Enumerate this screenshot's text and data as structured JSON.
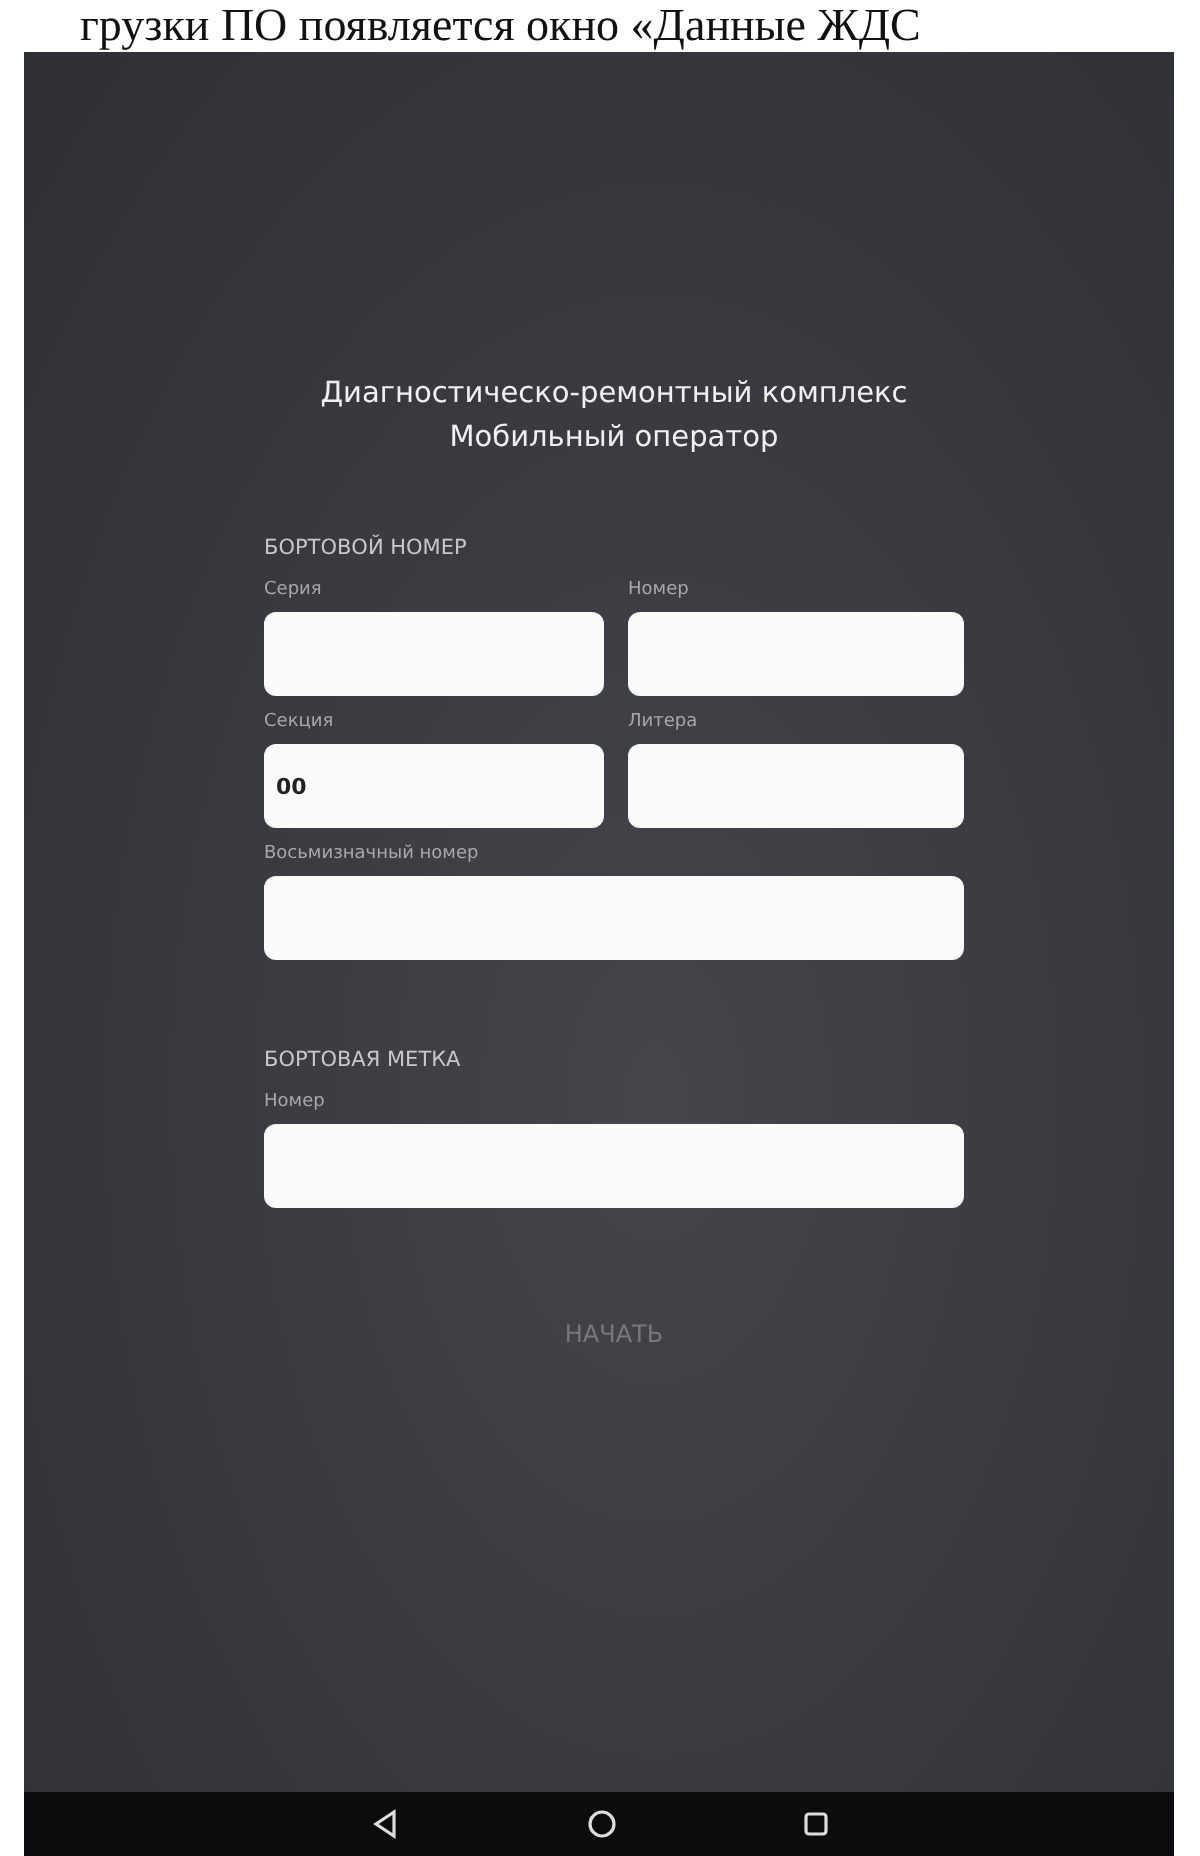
{
  "doc_text": "грузки ПО появляется окно «Данные ЖДС",
  "screen": {
    "title_lines": [
      "Диагностическо-ремонтный комплекс",
      "Мобильный оператор"
    ],
    "sections": [
      {
        "heading": "БОРТОВОЙ НОМЕР",
        "fields": [
          {
            "label": "Серия",
            "kind": "half"
          },
          {
            "label": "Номер",
            "kind": "half"
          },
          {
            "label": "Секция",
            "kind": "half",
            "value": "00"
          },
          {
            "label": "Литера",
            "kind": "half"
          },
          {
            "label": "Восьмизначный номер",
            "kind": "full"
          }
        ]
      },
      {
        "heading": "БОРТОВАЯ МЕТКА",
        "fields": [
          {
            "label": "Номер",
            "kind": "full"
          }
        ]
      }
    ],
    "button": {
      "label": "НАЧАТЬ",
      "disabled": true
    }
  },
  "nav_bar": {
    "buttons": [
      {
        "kind": "back"
      },
      {
        "kind": "home"
      },
      {
        "kind": "recents"
      }
    ]
  }
}
